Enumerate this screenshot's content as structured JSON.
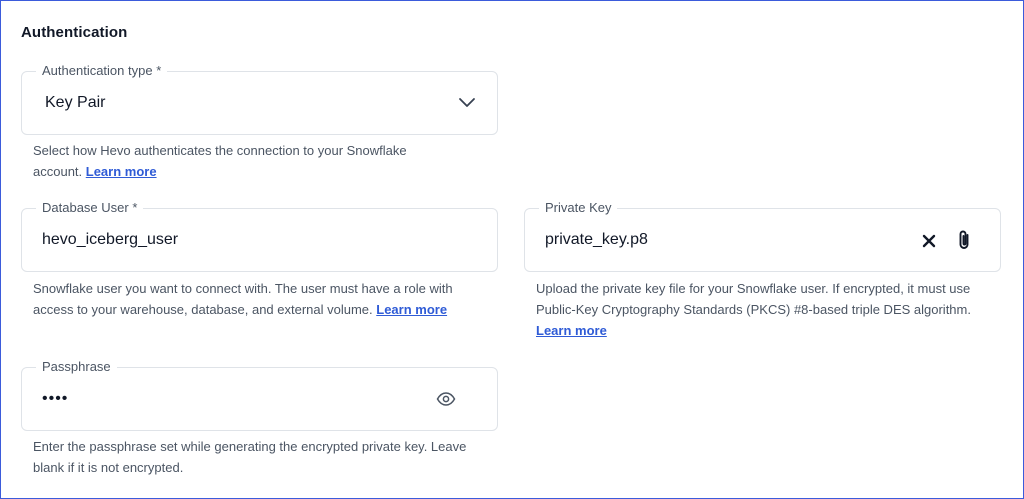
{
  "section": {
    "title": "Authentication"
  },
  "auth_type": {
    "label": "Authentication type *",
    "value": "Key Pair",
    "help_text": "Select how Hevo authenticates the connection to your Snowflake account. ",
    "help_link": "Learn more"
  },
  "db_user": {
    "label": "Database User *",
    "value": "hevo_iceberg_user",
    "help_text": "Snowflake user you want to connect with. The user must have a role with access to your warehouse, database, and external volume. ",
    "help_link": "Learn more"
  },
  "private_key": {
    "label": "Private Key",
    "value": "private_key.p8",
    "help_text": "Upload the private key file for your Snowflake user. If encrypted, it must use Public-Key Cryptography Standards (PKCS) #8-based triple DES algorithm. ",
    "help_link": "Learn more"
  },
  "passphrase": {
    "label": "Passphrase",
    "value": "••••",
    "help_text": "Enter the passphrase set while generating the encrypted private key. Leave blank if it is not encrypted."
  },
  "colors": {
    "link": "#2f5bd6",
    "border": "#dfe3e8",
    "frame": "#3b5bdb"
  },
  "icons": {
    "dropdown": "chevron-down-icon",
    "clear": "close-icon",
    "attach": "paperclip-icon",
    "reveal": "eye-icon"
  }
}
